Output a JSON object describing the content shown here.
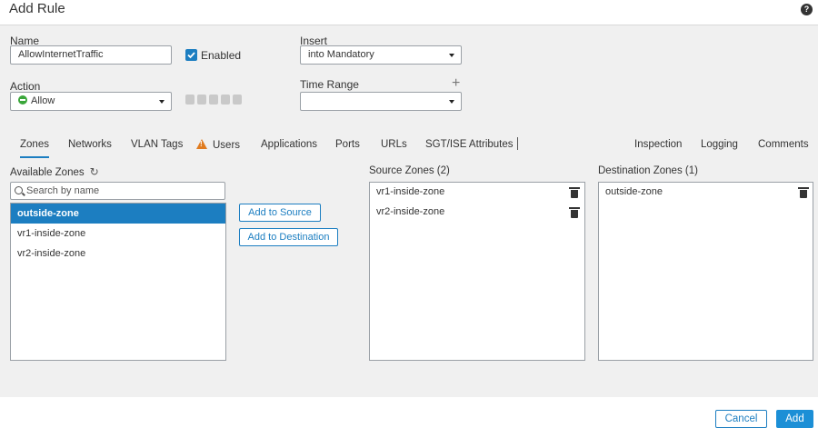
{
  "dialog": {
    "title": "Add Rule"
  },
  "form": {
    "name_label": "Name",
    "name_value": "AllowInternetTraffic",
    "enabled_label": "Enabled",
    "enabled_checked": true,
    "insert_label": "Insert",
    "insert_value": "into Mandatory",
    "action_label": "Action",
    "action_value": "Allow",
    "time_range_label": "Time Range",
    "time_range_value": ""
  },
  "tabs": [
    {
      "label": "Zones",
      "active": true
    },
    {
      "label": "Networks"
    },
    {
      "label": "VLAN Tags"
    },
    {
      "label": "Users",
      "warning": true
    },
    {
      "label": "Applications"
    },
    {
      "label": "Ports"
    },
    {
      "label": "URLs"
    },
    {
      "label": "SGT/ISE Attributes"
    },
    {
      "label": "Inspection"
    },
    {
      "label": "Logging"
    },
    {
      "label": "Comments"
    }
  ],
  "available": {
    "title": "Available Zones",
    "search_placeholder": "Search by name",
    "items": [
      "outside-zone",
      "vr1-inside-zone",
      "vr2-inside-zone"
    ],
    "selected": "outside-zone"
  },
  "buttons": {
    "add_source": "Add to Source",
    "add_destination": "Add to Destination",
    "cancel": "Cancel",
    "add": "Add"
  },
  "source": {
    "title": "Source Zones (2)",
    "items": [
      "vr1-inside-zone",
      "vr2-inside-zone"
    ]
  },
  "destination": {
    "title": "Destination Zones (1)",
    "items": [
      "outside-zone"
    ]
  },
  "colors": {
    "accent": "#1c7ec1",
    "allow": "#3aa63a",
    "warning": "#e07b1f"
  },
  "icons": [
    "help-icon",
    "checkbox-check-icon",
    "allow-icon",
    "plus-icon",
    "warning-icon",
    "refresh-icon",
    "search-icon",
    "trash-icon"
  ]
}
